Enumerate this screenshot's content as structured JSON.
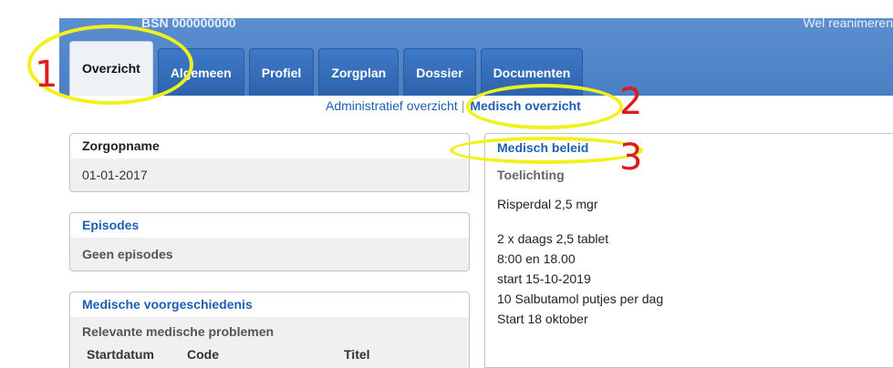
{
  "header": {
    "patient_id": "BSN 000000000",
    "status_text": "Wel reanimeren"
  },
  "tabs": [
    {
      "label": "Overzicht",
      "active": true
    },
    {
      "label": "Algemeen"
    },
    {
      "label": "Profiel"
    },
    {
      "label": "Zorgplan"
    },
    {
      "label": "Dossier"
    },
    {
      "label": "Documenten"
    }
  ],
  "subnav": {
    "admin_link": "Administratief overzicht",
    "separator": "|",
    "medical_link": "Medisch overzicht"
  },
  "zorgopname": {
    "title": "Zorgopname",
    "date": "01-01-2017"
  },
  "episodes": {
    "title": "Episodes",
    "empty_text": "Geen episodes"
  },
  "history": {
    "title": "Medische voorgeschiedenis",
    "subtitle": "Relevante medische problemen",
    "columns": [
      "Startdatum",
      "Code",
      "Titel"
    ]
  },
  "beleid": {
    "title": "Medisch beleid",
    "subtitle": "Toelichting",
    "line1": "Risperdal 2,5 mgr",
    "lines": [
      "2 x daags 2,5 tablet",
      "8:00 en 18.00",
      "start 15-10-2019",
      "10 Salbutamol putjes per dag",
      "Start 18 oktober"
    ]
  },
  "annotations": {
    "one": "1",
    "two": "2",
    "three": "3",
    "color_circle": "#f1f11c",
    "color_number": "#e01b1b"
  }
}
